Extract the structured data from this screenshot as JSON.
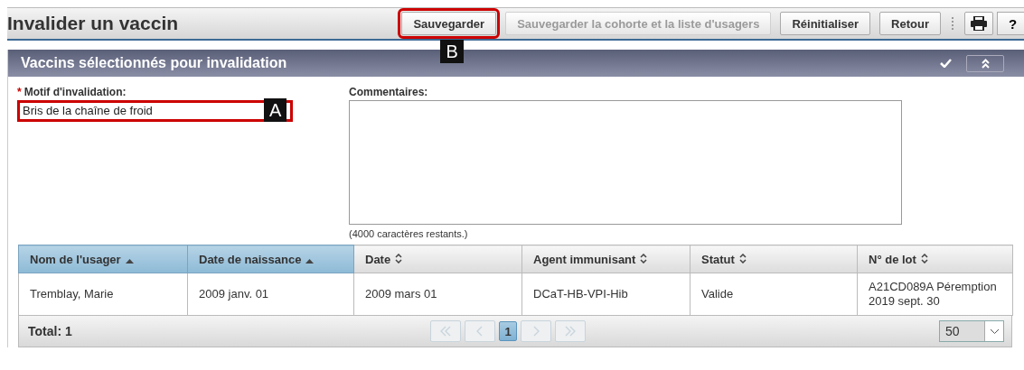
{
  "page": {
    "title": "Invalider un vaccin"
  },
  "toolbar": {
    "buttons": [
      {
        "label": "Sauvegarder",
        "disabled": false,
        "callout": "B"
      },
      {
        "label": "Sauvegarder la cohorte et la liste d'usagers",
        "disabled": true
      },
      {
        "label": "Réinitialiser",
        "disabled": false
      },
      {
        "label": "Retour",
        "disabled": false
      }
    ],
    "help": "?"
  },
  "panel": {
    "title": "Vaccins sélectionnés pour invalidation",
    "reason": {
      "label": "Motif d'invalidation:",
      "required_mark": "*",
      "value": "Bris de la chaîne de froid",
      "callout": "A"
    },
    "comments": {
      "label": "Commentaires:",
      "remaining": "(4000 caractères restants.)"
    }
  },
  "table": {
    "columns": [
      {
        "label": "Nom de l'usager",
        "sorted": true
      },
      {
        "label": "Date de naissance",
        "sorted": true
      },
      {
        "label": "Date",
        "sorted": false
      },
      {
        "label": "Agent immunisant",
        "sorted": false
      },
      {
        "label": "Statut",
        "sorted": false
      },
      {
        "label": "N° de lot",
        "sorted": false
      }
    ],
    "rows": [
      [
        "Tremblay, Marie",
        "2009 janv. 01",
        "2009 mars 01",
        "DCaT-HB-VPI-Hib",
        "Valide",
        "A21CD089A Péremption 2019 sept. 30"
      ]
    ],
    "total": "Total: 1",
    "pages": [
      {
        "label": "1",
        "selected": true
      }
    ],
    "page_size": "50"
  }
}
